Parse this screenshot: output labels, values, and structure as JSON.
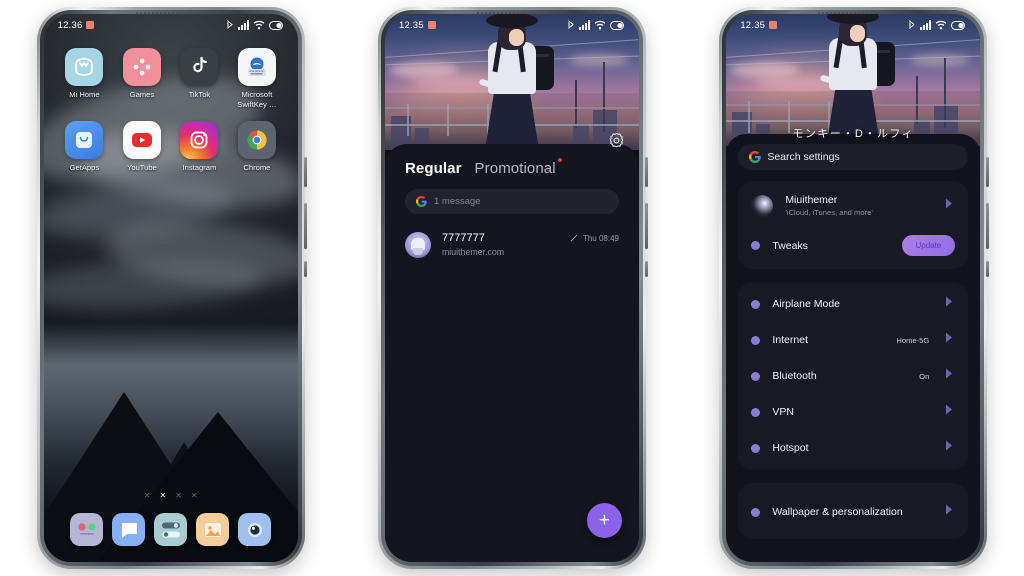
{
  "phones": [
    {
      "id": "home-screen",
      "statusbar": {
        "time": "12.36",
        "icons": [
          "bluetooth-icon",
          "signal-icon",
          "wifi-icon",
          "battery-icon"
        ]
      },
      "apps": [
        {
          "label": "Mi Home",
          "icon": "mi-home-icon"
        },
        {
          "label": "Games",
          "icon": "games-icon"
        },
        {
          "label": "TikTok",
          "icon": "tiktok-icon"
        },
        {
          "label": "Microsoft SwiftKey …",
          "icon": "swiftkey-icon"
        },
        {
          "label": "GetApps",
          "icon": "getapps-icon"
        },
        {
          "label": "YouTube",
          "icon": "youtube-icon"
        },
        {
          "label": "Instagram",
          "icon": "instagram-icon"
        },
        {
          "label": "Chrome",
          "icon": "chrome-icon"
        }
      ],
      "pager": {
        "count": 4,
        "active_index": 1,
        "glyph": "✕"
      },
      "dock": [
        {
          "name": "phone-dock-icon"
        },
        {
          "name": "messages-dock-icon"
        },
        {
          "name": "settings-dock-icon"
        },
        {
          "name": "gallery-dock-icon"
        },
        {
          "name": "camera-dock-icon"
        }
      ]
    },
    {
      "id": "messages-screen",
      "statusbar": {
        "time": "12.35",
        "icons": [
          "bluetooth-icon",
          "signal-icon",
          "wifi-icon",
          "battery-icon"
        ]
      },
      "tabs": [
        {
          "label": "Regular",
          "active": true,
          "badge": false
        },
        {
          "label": "Promotional",
          "active": false,
          "badge": true
        }
      ],
      "search": {
        "placeholder": "1 message",
        "icon": "google-icon"
      },
      "messages": [
        {
          "sender": "7777777",
          "preview": "miuithemer.com",
          "time": "Thu 08:49",
          "status_icon": "sent-check-icon"
        }
      ],
      "fab": {
        "label": "+",
        "name": "compose-button"
      },
      "gear": {
        "name": "settings-gear-icon"
      }
    },
    {
      "id": "settings-screen",
      "statusbar": {
        "time": "12.35",
        "icons": [
          "bluetooth-icon",
          "signal-icon",
          "wifi-icon",
          "battery-icon"
        ]
      },
      "wallpaper_title": "モンキー・D・ルフィ",
      "search": {
        "label": "Search settings",
        "icon": "google-icon"
      },
      "account_card": [
        {
          "title": "Miuithemer",
          "subtitle": "'iCloud, iTunes, and more'",
          "type": "account",
          "chevron": true
        },
        {
          "title": "Tweaks",
          "type": "bullet",
          "action": "Update"
        }
      ],
      "settings_card": [
        {
          "title": "Airplane Mode",
          "value": "",
          "chevron": true
        },
        {
          "title": "Internet",
          "value": "Home-5G",
          "chevron": true
        },
        {
          "title": "Bluetooth",
          "value": "On",
          "chevron": true
        },
        {
          "title": "VPN",
          "value": "",
          "chevron": true
        },
        {
          "title": "Hotspot",
          "value": "",
          "chevron": true
        }
      ],
      "bottom_card": [
        {
          "title": "Wallpaper & personalization",
          "value": "",
          "chevron": true
        }
      ]
    }
  ],
  "colors": {
    "accent_purple": "#8a63e8",
    "bullet_purple": "#8b7ad6",
    "badge_red": "#e0323c",
    "sheet_bg": "#151520",
    "card_bg": "#191926",
    "page_bg": "#ffffff"
  }
}
